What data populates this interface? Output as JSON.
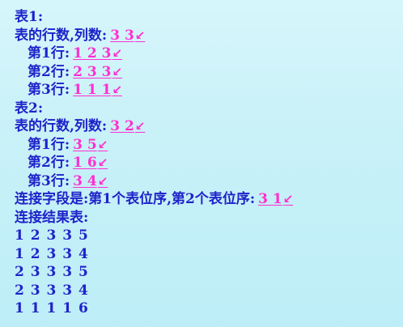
{
  "document": {
    "table1_title": "表1:",
    "table1_dims_prompt": "表的行数,列数:",
    "table1_dims_input": "3 3",
    "table1_rows": [
      {
        "label": "第1行:",
        "input": "1 2 3"
      },
      {
        "label": "第2行:",
        "input": "2 3 3"
      },
      {
        "label": "第3行:",
        "input": "1 1 1"
      }
    ],
    "table2_title": "表2:",
    "table2_dims_prompt": "表的行数,列数:",
    "table2_dims_input": "3 2",
    "table2_rows": [
      {
        "label": "第1行:",
        "input": "3 5"
      },
      {
        "label": "第2行:",
        "input": "1 6"
      },
      {
        "label": "第3行:",
        "input": "3 4"
      }
    ],
    "join_prompt": "连接字段是:第1个表位序,第2个表位序:",
    "join_input": "3 1",
    "result_title": "连接结果表:",
    "result_rows": [
      "1 2 3 3 5",
      "1 2 3 3 4",
      "2 3 3 3 5",
      "2 3 3 3 4",
      "1 1 1 1 6"
    ],
    "enter_symbol": "↙"
  },
  "colors": {
    "text": "#1f23c9",
    "input": "#ff2fcf",
    "background_top": "#d6f6fb",
    "background_bottom": "#bdeef7"
  }
}
